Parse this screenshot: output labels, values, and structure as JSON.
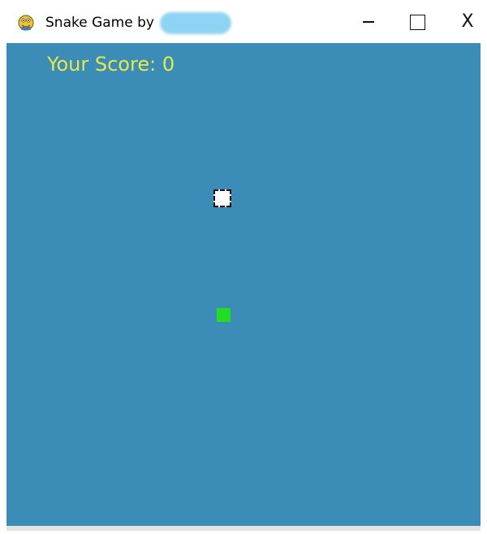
{
  "window": {
    "title": "Snake Game by",
    "minimize_icon": "minimize-icon",
    "maximize_icon": "maximize-icon",
    "close_glyph": "X",
    "app_icon": "python-snake-icon"
  },
  "game": {
    "score_label": "Your Score:",
    "score_value": "0",
    "colors": {
      "background": "#3c8cb8",
      "score_text": "#e8e84a",
      "snake": "#22dd22",
      "food": "#ffffff"
    }
  }
}
